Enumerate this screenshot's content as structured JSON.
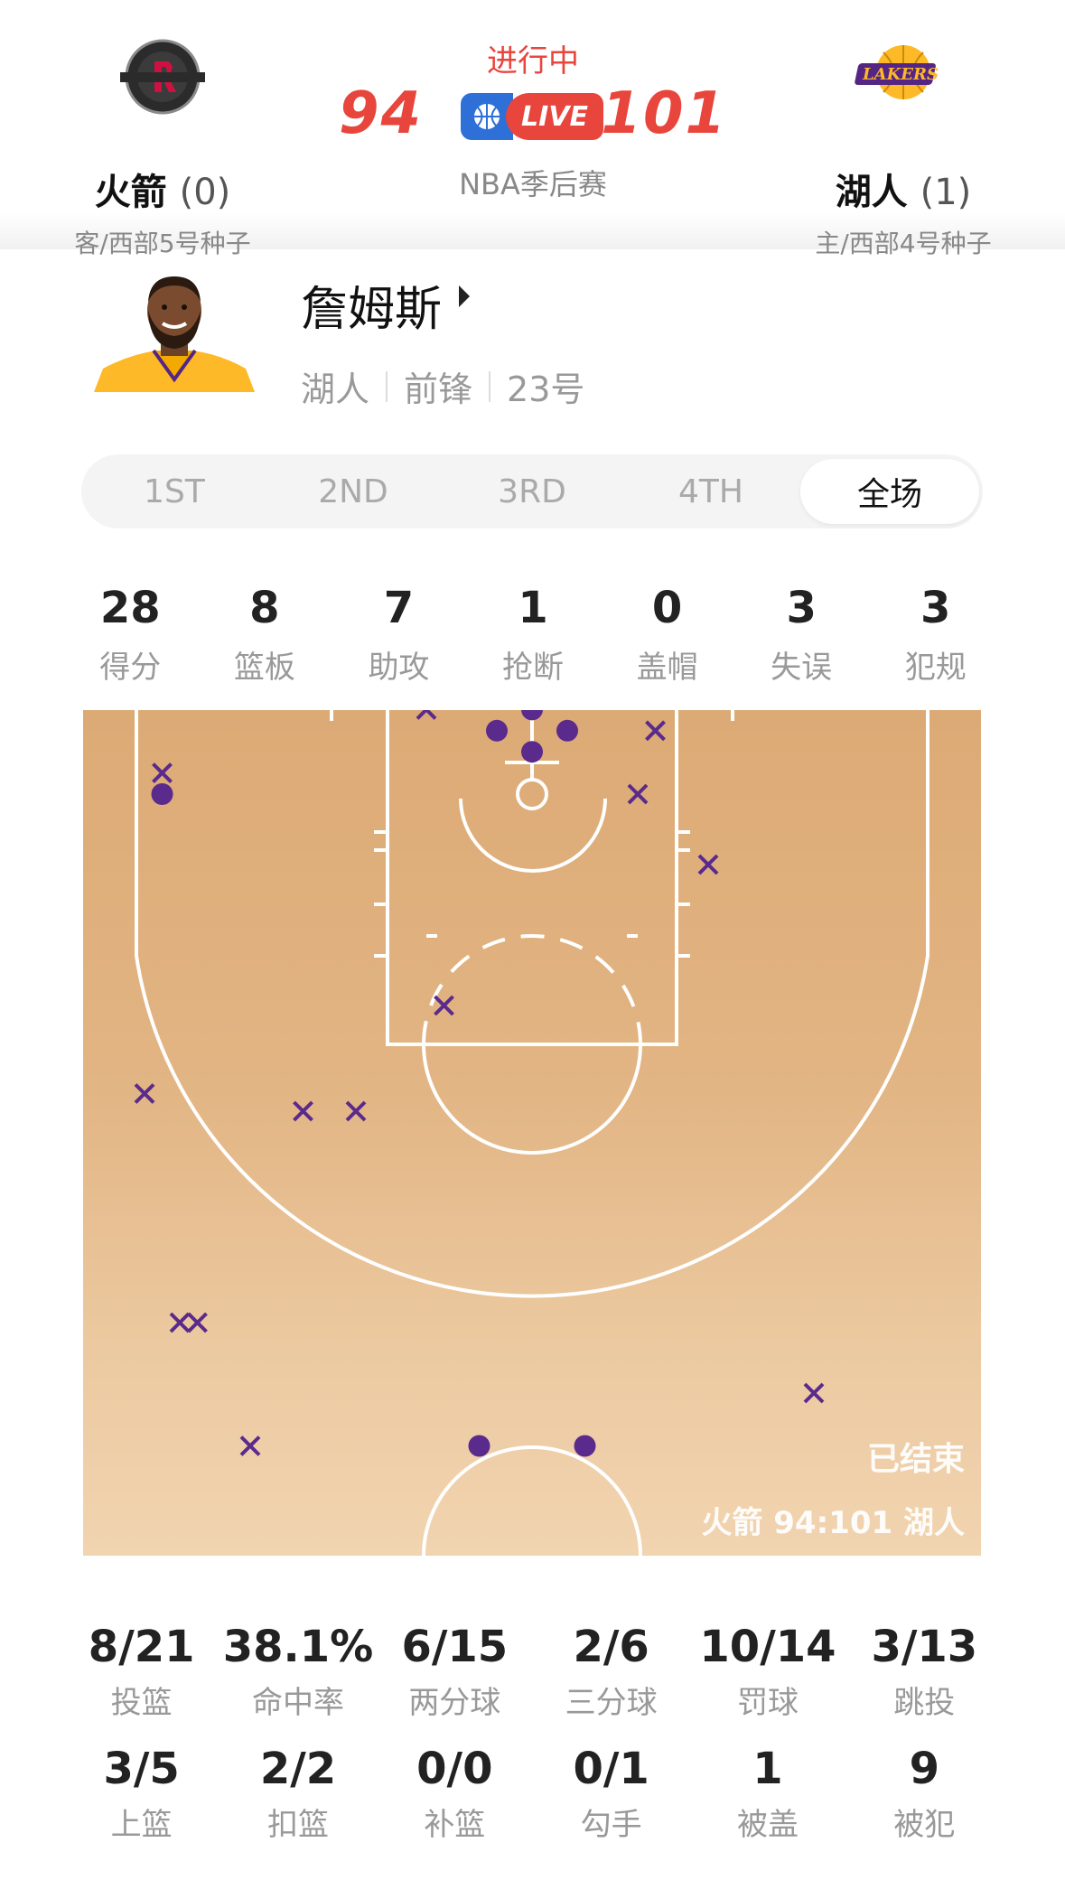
{
  "header": {
    "status": "进行中",
    "game_type": "NBA季后赛",
    "live_label": "LIVE",
    "away": {
      "name": "火箭",
      "series": "(0)",
      "seed": "客/西部5号种子",
      "score": "94",
      "logo_text": "HOUSTON ROCKETS",
      "color": "#ce1141"
    },
    "home": {
      "name": "湖人",
      "series": "(1)",
      "seed": "主/西部4号种子",
      "score": "101",
      "logo_text": "LAKERS",
      "color": "#552583"
    }
  },
  "player": {
    "name": "詹姆斯",
    "team": "湖人",
    "position": "前锋",
    "number": "23号"
  },
  "tabs": [
    {
      "label": "1ST",
      "active": false
    },
    {
      "label": "2ND",
      "active": false
    },
    {
      "label": "3RD",
      "active": false
    },
    {
      "label": "4TH",
      "active": false
    },
    {
      "label": "全场",
      "active": true
    }
  ],
  "summary": [
    {
      "value": "28",
      "label": "得分"
    },
    {
      "value": "8",
      "label": "篮板"
    },
    {
      "value": "7",
      "label": "助攻"
    },
    {
      "value": "1",
      "label": "抢断"
    },
    {
      "value": "0",
      "label": "盖帽"
    },
    {
      "value": "3",
      "label": "失误"
    },
    {
      "value": "3",
      "label": "犯规"
    }
  ],
  "court": {
    "status": "已结束",
    "final_score": "火箭 94:101 湖人",
    "marker_color": "#5a2a8c",
    "line_color": "#ffffff",
    "shots": [
      {
        "x": 0,
        "y": 4,
        "made": true
      },
      {
        "x": -2,
        "y": 6,
        "made": true
      },
      {
        "x": 2,
        "y": 6,
        "made": true
      },
      {
        "x": 0,
        "y": 8,
        "made": true
      },
      {
        "x": -6,
        "y": 8,
        "made": false
      },
      {
        "x": 7,
        "y": 6,
        "made": false
      },
      {
        "x": 6,
        "y": 0,
        "made": false
      },
      {
        "x": 10,
        "y": -4,
        "made": false
      },
      {
        "x": -5,
        "y": -12,
        "made": false
      },
      {
        "x": -13,
        "y": -18,
        "made": false
      },
      {
        "x": -10,
        "y": -18,
        "made": false
      },
      {
        "x": -22,
        "y": -17,
        "made": false
      },
      {
        "x": -21,
        "y": 2,
        "made": false
      },
      {
        "x": -21,
        "y": 0,
        "made": true
      },
      {
        "x": -20,
        "y": -30,
        "made": false
      },
      {
        "x": -19,
        "y": -30,
        "made": false
      },
      {
        "x": -16,
        "y": -37,
        "made": false
      },
      {
        "x": -3,
        "y": -37,
        "made": true
      },
      {
        "x": 3,
        "y": -37,
        "made": true
      },
      {
        "x": 16,
        "y": -34,
        "made": false
      }
    ]
  },
  "shooting": [
    {
      "value": "8/21",
      "label": "投篮"
    },
    {
      "value": "38.1%",
      "label": "命中率"
    },
    {
      "value": "6/15",
      "label": "两分球"
    },
    {
      "value": "2/6",
      "label": "三分球"
    },
    {
      "value": "10/14",
      "label": "罚球"
    },
    {
      "value": "3/13",
      "label": "跳投"
    }
  ],
  "shot_types": [
    {
      "value": "3/5",
      "label": "上篮"
    },
    {
      "value": "2/2",
      "label": "扣篮"
    },
    {
      "value": "0/0",
      "label": "补篮"
    },
    {
      "value": "0/1",
      "label": "勾手"
    },
    {
      "value": "1",
      "label": "被盖"
    },
    {
      "value": "9",
      "label": "被犯"
    }
  ]
}
